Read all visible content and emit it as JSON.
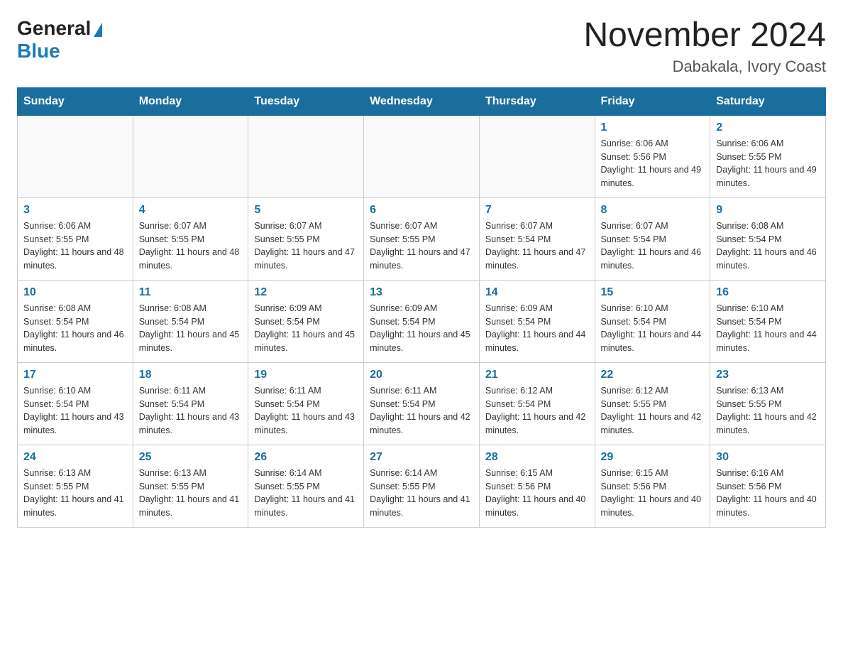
{
  "header": {
    "logo_general": "General",
    "logo_blue": "Blue",
    "month_year": "November 2024",
    "location": "Dabakala, Ivory Coast"
  },
  "days_of_week": [
    "Sunday",
    "Monday",
    "Tuesday",
    "Wednesday",
    "Thursday",
    "Friday",
    "Saturday"
  ],
  "weeks": [
    [
      {
        "day": "",
        "sunrise": "",
        "sunset": "",
        "daylight": ""
      },
      {
        "day": "",
        "sunrise": "",
        "sunset": "",
        "daylight": ""
      },
      {
        "day": "",
        "sunrise": "",
        "sunset": "",
        "daylight": ""
      },
      {
        "day": "",
        "sunrise": "",
        "sunset": "",
        "daylight": ""
      },
      {
        "day": "",
        "sunrise": "",
        "sunset": "",
        "daylight": ""
      },
      {
        "day": "1",
        "sunrise": "Sunrise: 6:06 AM",
        "sunset": "Sunset: 5:56 PM",
        "daylight": "Daylight: 11 hours and 49 minutes."
      },
      {
        "day": "2",
        "sunrise": "Sunrise: 6:06 AM",
        "sunset": "Sunset: 5:55 PM",
        "daylight": "Daylight: 11 hours and 49 minutes."
      }
    ],
    [
      {
        "day": "3",
        "sunrise": "Sunrise: 6:06 AM",
        "sunset": "Sunset: 5:55 PM",
        "daylight": "Daylight: 11 hours and 48 minutes."
      },
      {
        "day": "4",
        "sunrise": "Sunrise: 6:07 AM",
        "sunset": "Sunset: 5:55 PM",
        "daylight": "Daylight: 11 hours and 48 minutes."
      },
      {
        "day": "5",
        "sunrise": "Sunrise: 6:07 AM",
        "sunset": "Sunset: 5:55 PM",
        "daylight": "Daylight: 11 hours and 47 minutes."
      },
      {
        "day": "6",
        "sunrise": "Sunrise: 6:07 AM",
        "sunset": "Sunset: 5:55 PM",
        "daylight": "Daylight: 11 hours and 47 minutes."
      },
      {
        "day": "7",
        "sunrise": "Sunrise: 6:07 AM",
        "sunset": "Sunset: 5:54 PM",
        "daylight": "Daylight: 11 hours and 47 minutes."
      },
      {
        "day": "8",
        "sunrise": "Sunrise: 6:07 AM",
        "sunset": "Sunset: 5:54 PM",
        "daylight": "Daylight: 11 hours and 46 minutes."
      },
      {
        "day": "9",
        "sunrise": "Sunrise: 6:08 AM",
        "sunset": "Sunset: 5:54 PM",
        "daylight": "Daylight: 11 hours and 46 minutes."
      }
    ],
    [
      {
        "day": "10",
        "sunrise": "Sunrise: 6:08 AM",
        "sunset": "Sunset: 5:54 PM",
        "daylight": "Daylight: 11 hours and 46 minutes."
      },
      {
        "day": "11",
        "sunrise": "Sunrise: 6:08 AM",
        "sunset": "Sunset: 5:54 PM",
        "daylight": "Daylight: 11 hours and 45 minutes."
      },
      {
        "day": "12",
        "sunrise": "Sunrise: 6:09 AM",
        "sunset": "Sunset: 5:54 PM",
        "daylight": "Daylight: 11 hours and 45 minutes."
      },
      {
        "day": "13",
        "sunrise": "Sunrise: 6:09 AM",
        "sunset": "Sunset: 5:54 PM",
        "daylight": "Daylight: 11 hours and 45 minutes."
      },
      {
        "day": "14",
        "sunrise": "Sunrise: 6:09 AM",
        "sunset": "Sunset: 5:54 PM",
        "daylight": "Daylight: 11 hours and 44 minutes."
      },
      {
        "day": "15",
        "sunrise": "Sunrise: 6:10 AM",
        "sunset": "Sunset: 5:54 PM",
        "daylight": "Daylight: 11 hours and 44 minutes."
      },
      {
        "day": "16",
        "sunrise": "Sunrise: 6:10 AM",
        "sunset": "Sunset: 5:54 PM",
        "daylight": "Daylight: 11 hours and 44 minutes."
      }
    ],
    [
      {
        "day": "17",
        "sunrise": "Sunrise: 6:10 AM",
        "sunset": "Sunset: 5:54 PM",
        "daylight": "Daylight: 11 hours and 43 minutes."
      },
      {
        "day": "18",
        "sunrise": "Sunrise: 6:11 AM",
        "sunset": "Sunset: 5:54 PM",
        "daylight": "Daylight: 11 hours and 43 minutes."
      },
      {
        "day": "19",
        "sunrise": "Sunrise: 6:11 AM",
        "sunset": "Sunset: 5:54 PM",
        "daylight": "Daylight: 11 hours and 43 minutes."
      },
      {
        "day": "20",
        "sunrise": "Sunrise: 6:11 AM",
        "sunset": "Sunset: 5:54 PM",
        "daylight": "Daylight: 11 hours and 42 minutes."
      },
      {
        "day": "21",
        "sunrise": "Sunrise: 6:12 AM",
        "sunset": "Sunset: 5:54 PM",
        "daylight": "Daylight: 11 hours and 42 minutes."
      },
      {
        "day": "22",
        "sunrise": "Sunrise: 6:12 AM",
        "sunset": "Sunset: 5:55 PM",
        "daylight": "Daylight: 11 hours and 42 minutes."
      },
      {
        "day": "23",
        "sunrise": "Sunrise: 6:13 AM",
        "sunset": "Sunset: 5:55 PM",
        "daylight": "Daylight: 11 hours and 42 minutes."
      }
    ],
    [
      {
        "day": "24",
        "sunrise": "Sunrise: 6:13 AM",
        "sunset": "Sunset: 5:55 PM",
        "daylight": "Daylight: 11 hours and 41 minutes."
      },
      {
        "day": "25",
        "sunrise": "Sunrise: 6:13 AM",
        "sunset": "Sunset: 5:55 PM",
        "daylight": "Daylight: 11 hours and 41 minutes."
      },
      {
        "day": "26",
        "sunrise": "Sunrise: 6:14 AM",
        "sunset": "Sunset: 5:55 PM",
        "daylight": "Daylight: 11 hours and 41 minutes."
      },
      {
        "day": "27",
        "sunrise": "Sunrise: 6:14 AM",
        "sunset": "Sunset: 5:55 PM",
        "daylight": "Daylight: 11 hours and 41 minutes."
      },
      {
        "day": "28",
        "sunrise": "Sunrise: 6:15 AM",
        "sunset": "Sunset: 5:56 PM",
        "daylight": "Daylight: 11 hours and 40 minutes."
      },
      {
        "day": "29",
        "sunrise": "Sunrise: 6:15 AM",
        "sunset": "Sunset: 5:56 PM",
        "daylight": "Daylight: 11 hours and 40 minutes."
      },
      {
        "day": "30",
        "sunrise": "Sunrise: 6:16 AM",
        "sunset": "Sunset: 5:56 PM",
        "daylight": "Daylight: 11 hours and 40 minutes."
      }
    ]
  ]
}
